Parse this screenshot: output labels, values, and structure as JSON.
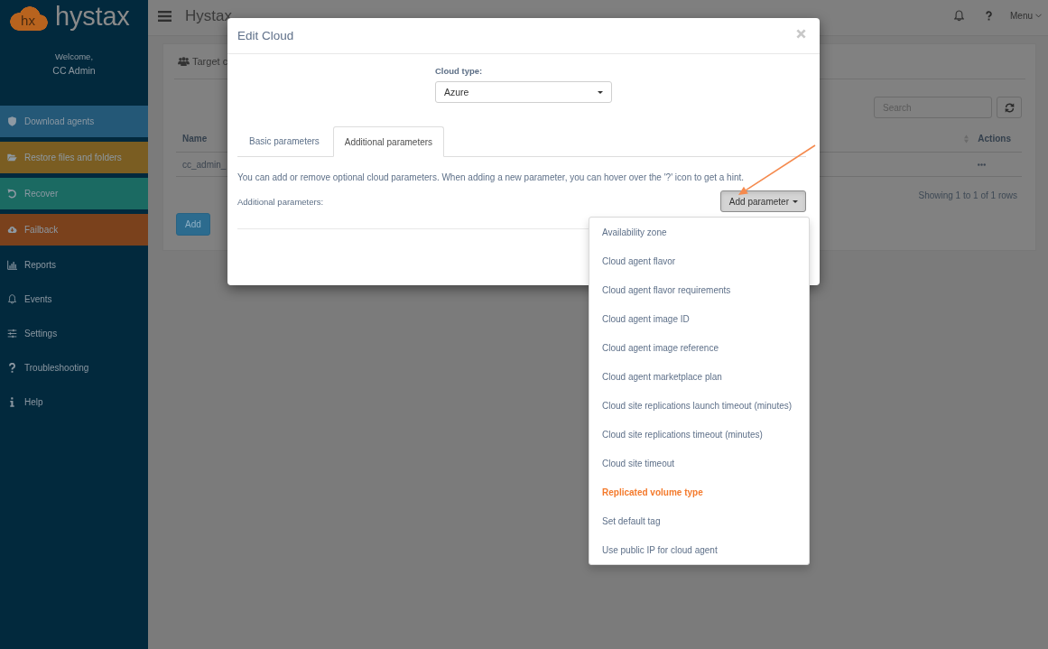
{
  "sidebar": {
    "logo": {
      "mark": "hx",
      "name": "hystax"
    },
    "welcome": "Welcome,",
    "user": "CC Admin",
    "items": [
      {
        "label": "Download agents",
        "kind": "tile",
        "color": "#245877"
      },
      {
        "label": "Restore files and folders",
        "kind": "tile",
        "color": "#7a5d22"
      },
      {
        "label": "Recover",
        "kind": "tile",
        "color": "#1b6a62"
      },
      {
        "label": "Failback",
        "kind": "tile",
        "color": "#7a411c"
      },
      {
        "label": "Reports",
        "kind": "plain"
      },
      {
        "label": "Events",
        "kind": "plain"
      },
      {
        "label": "Settings",
        "kind": "plain"
      },
      {
        "label": "Troubleshooting",
        "kind": "plain"
      },
      {
        "label": "Help",
        "kind": "plain"
      }
    ]
  },
  "header": {
    "title": "Hystax",
    "menu": "Menu"
  },
  "panel": {
    "title": "Target c",
    "search": {
      "placeholder": "Search"
    },
    "table": {
      "columns": [
        "Name",
        "Actions"
      ],
      "rows": [
        {
          "name": "cc_admin_"
        }
      ]
    },
    "footer": "Showing 1 to 1 of 1 rows",
    "add_button": "Add"
  },
  "modal": {
    "title": "Edit Cloud",
    "cloud_type": {
      "label": "Cloud type:",
      "value": "Azure"
    },
    "tabs": [
      {
        "label": "Basic parameters",
        "selected": false
      },
      {
        "label": "Additional parameters",
        "selected": true
      }
    ],
    "hint": "You can add or remove optional cloud parameters. When adding a new parameter, you can hover over the '?' icon to get a hint.",
    "params_label": "Additional parameters:",
    "add_parameter": {
      "label": "Add parameter",
      "pressed": true
    },
    "menu": [
      {
        "label": "Availability zone",
        "selected": false
      },
      {
        "label": "Cloud agent flavor",
        "selected": false
      },
      {
        "label": "Cloud agent flavor requirements",
        "selected": false
      },
      {
        "label": "Cloud agent image ID",
        "selected": false
      },
      {
        "label": "Cloud agent image reference",
        "selected": false
      },
      {
        "label": "Cloud agent marketplace plan",
        "selected": false
      },
      {
        "label": "Cloud site replications launch timeout (minutes)",
        "selected": false
      },
      {
        "label": "Cloud site replications timeout (minutes)",
        "selected": false
      },
      {
        "label": "Cloud site timeout",
        "selected": false
      },
      {
        "label": "Replicated volume type",
        "selected": true
      },
      {
        "label": "Set default tag",
        "selected": false
      },
      {
        "label": "Use public IP for cloud agent",
        "selected": false
      }
    ]
  }
}
